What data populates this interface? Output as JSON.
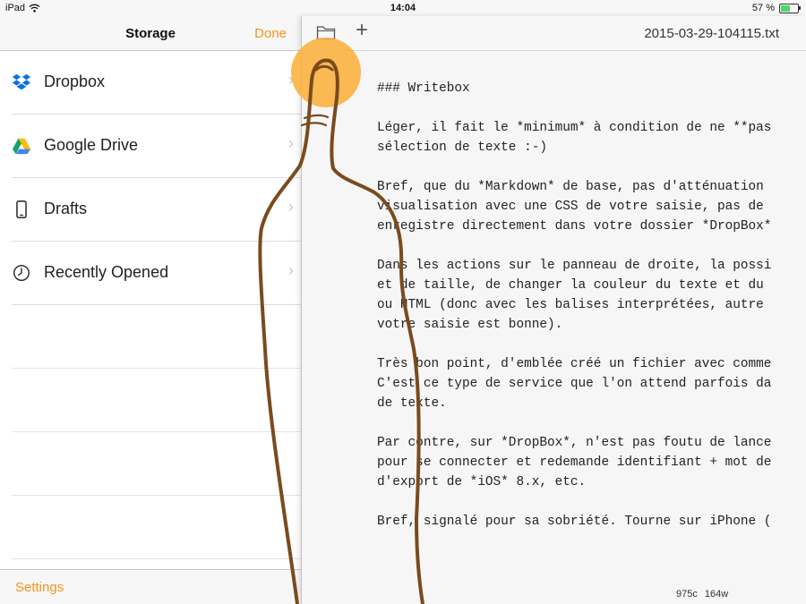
{
  "status_bar": {
    "device": "iPad",
    "time": "14:04",
    "battery": "57 %",
    "battery_level": 0.57
  },
  "storage_panel": {
    "title": "Storage",
    "done_label": "Done",
    "items": [
      {
        "label": "Dropbox",
        "icon": "dropbox-icon"
      },
      {
        "label": "Google Drive",
        "icon": "google-drive-icon"
      },
      {
        "label": "Drafts",
        "icon": "phone-icon"
      },
      {
        "label": "Recently Opened",
        "icon": "clock-icon"
      }
    ],
    "settings_label": "Settings"
  },
  "editor": {
    "filename": "2015-03-29-104115.txt",
    "lines": [
      "### Writebox",
      "",
      "Léger, il fait le *minimum* à condition de ne **pas",
      "sélection de texte :-)",
      "",
      "Bref, que du *Markdown* de base, pas d'atténuation",
      "visualisation avec une CSS de votre saisie, pas de",
      "enregistre directement dans votre dossier *DropBox*",
      "",
      "Dans les actions sur le panneau de droite, la possi",
      "et de taille, de changer la couleur du texte et du",
      "ou HTML (donc avec les balises interprétées, autre",
      "votre saisie est bonne).",
      "",
      "Très bon point, d'emblée créé un fichier avec comme",
      "C'est ce type de service que l'on attend parfois da",
      "de texte.",
      "",
      "Par contre, sur *DropBox*, n'est pas foutu de lance",
      "pour se connecter et redemande identifiant + mot de",
      "d'export de *iOS* 8.x, etc.",
      "",
      "Bref, signalé pour sa sobriété. Tourne sur iPhone ("
    ],
    "char_count": "975c",
    "word_count": "164w"
  },
  "colors": {
    "accent": "#f5941e",
    "touch": "#fbb03b",
    "finger_stroke": "#7a4a1e"
  }
}
